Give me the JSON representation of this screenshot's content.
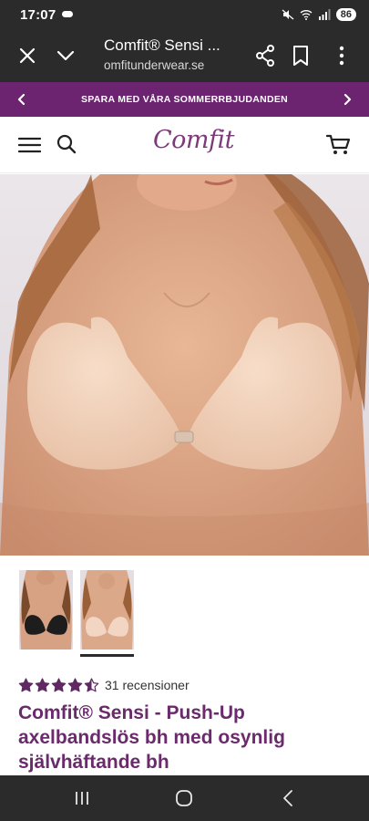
{
  "status_bar": {
    "time": "17:07",
    "battery": "86",
    "icons": [
      "cloud-icon",
      "mute-icon",
      "wifi-icon",
      "signal-icon",
      "battery-icon"
    ]
  },
  "browser": {
    "title": "Comfit® Sensi ...",
    "url": "omfitunderwear.se",
    "icons": [
      "close-icon",
      "chevron-down-icon",
      "share-icon",
      "bookmark-icon",
      "more-vert-icon"
    ]
  },
  "promo": {
    "text": "SPARA MED VÅRA SOMMERRBJUDANDEN",
    "icons": [
      "chevron-left-icon",
      "chevron-right-icon"
    ]
  },
  "header": {
    "logo_text": "Comfit",
    "icons": [
      "menu-icon",
      "search-icon",
      "cart-icon"
    ]
  },
  "product": {
    "rating": 4.5,
    "rating_color": "#5e2a61",
    "review_count": "31 recensioner",
    "title": "Comfit® Sensi - Push-Up axelbandslös bh med osynlig självhäftande bh",
    "title_color": "#6b2a6c",
    "gallery": [
      {
        "label": "black-variant",
        "selected": false
      },
      {
        "label": "nude-variant",
        "selected": true
      }
    ]
  },
  "colors": {
    "promo_bg": "#6c2370",
    "chrome_bg": "#2b2b2b",
    "brand": "#7c3a7a"
  }
}
